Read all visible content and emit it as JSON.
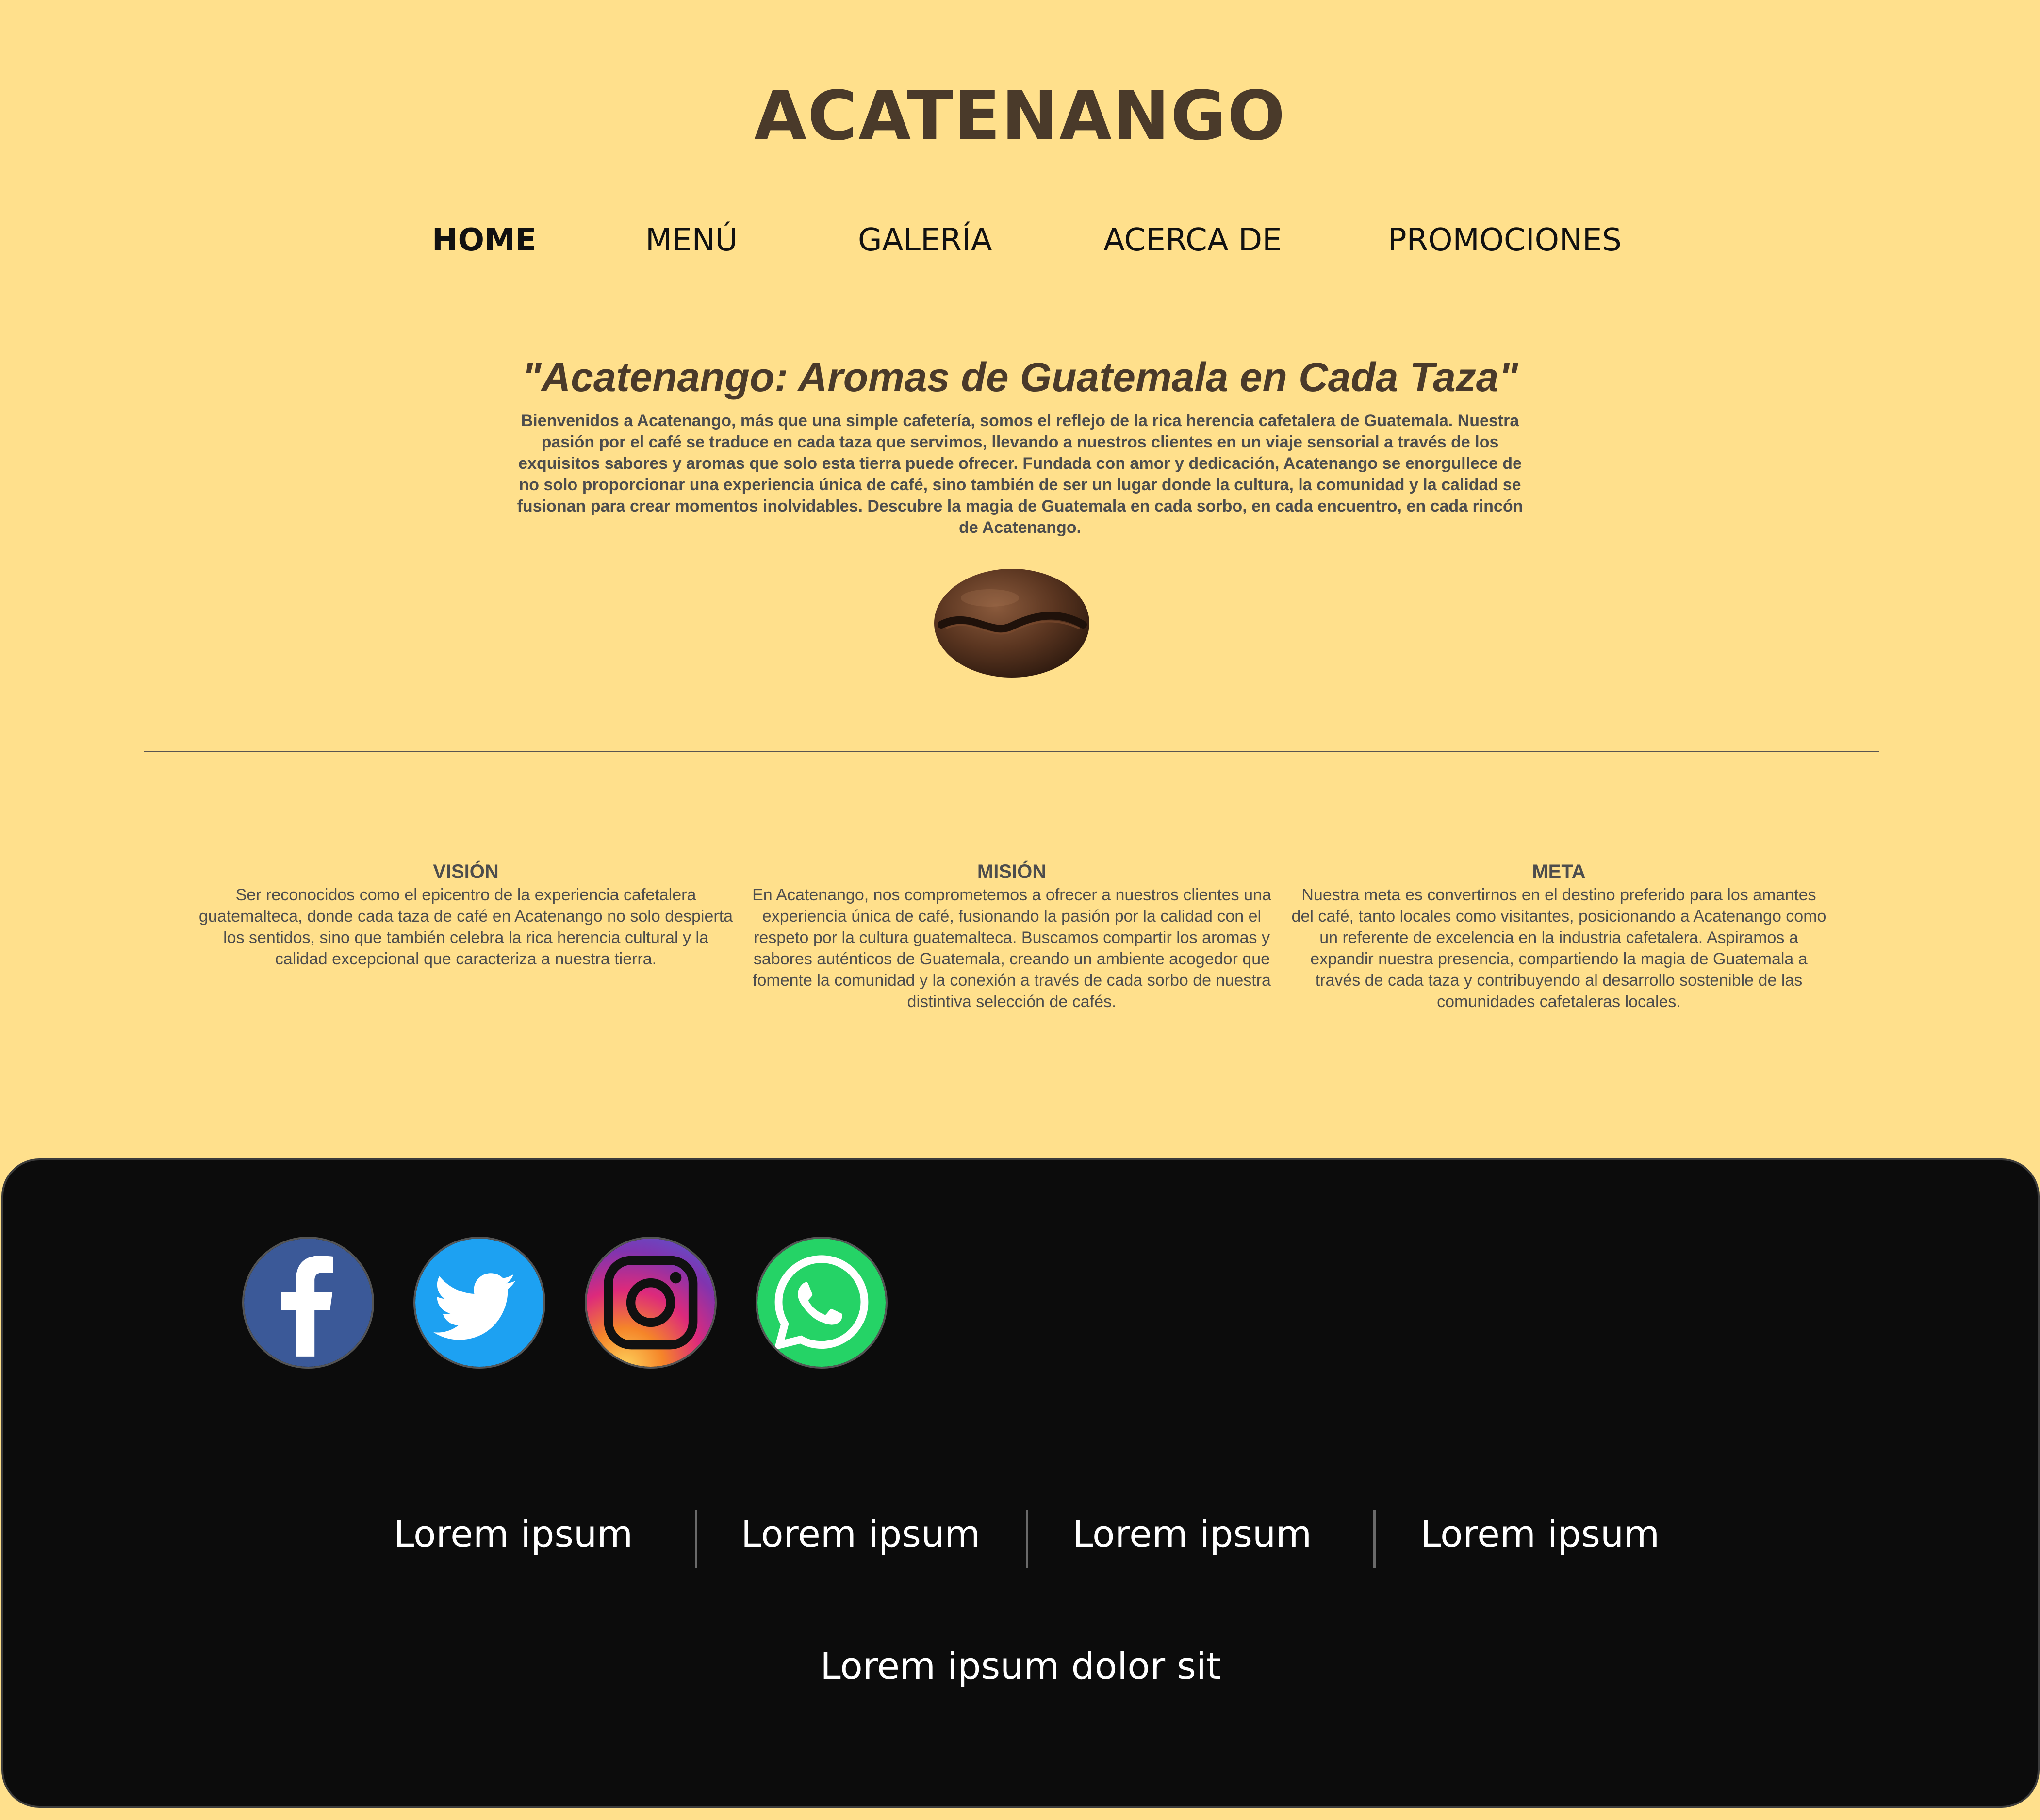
{
  "header": {
    "brand": "ACATENANGO"
  },
  "nav": {
    "items": [
      {
        "label": "HOME",
        "active": true
      },
      {
        "label": "MENÚ",
        "active": false
      },
      {
        "label": "GALERÍA",
        "active": false
      },
      {
        "label": "ACERCA DE",
        "active": false
      },
      {
        "label": "PROMOCIONES",
        "active": false
      }
    ]
  },
  "hero": {
    "title": "\"Acatenango: Aromas de Guatemala en Cada Taza\"",
    "text": "Bienvenidos a Acatenango, más que una simple cafetería, somos el reflejo de la rica herencia cafetalera de Guatemala. Nuestra pasión por el café se traduce en cada taza que servimos, llevando a nuestros clientes en un viaje sensorial a través de los exquisitos sabores y aromas que solo esta tierra puede ofrecer. Fundada con amor y dedicación, Acatenango se enorgullece de no solo proporcionar una experiencia única de café, sino también de ser un lugar donde la cultura, la comunidad y la calidad se fusionan para crear momentos inolvidables. Descubre la magia de Guatemala en cada sorbo, en cada encuentro, en cada rincón de Acatenango.",
    "image": "coffee-bean-image"
  },
  "columns": [
    {
      "title": "VISIÓN",
      "text": "Ser reconocidos como el epicentro de la experiencia cafetalera guatemalteca, donde cada taza de café en Acatenango no solo despierta los sentidos, sino que también celebra la rica herencia cultural y la calidad excepcional que caracteriza a nuestra tierra."
    },
    {
      "title": "MISIÓN",
      "text": "En Acatenango, nos comprometemos a ofrecer a nuestros clientes una experiencia única de café, fusionando la pasión por la calidad con el respeto por la cultura guatemalteca. Buscamos compartir los aromas y sabores auténticos de Guatemala, creando un ambiente acogedor que fomente la comunidad y la conexión a través de cada sorbo de nuestra distintiva selección de cafés."
    },
    {
      "title": "META",
      "text": "Nuestra meta es convertirnos en el destino preferido para los amantes del café, tanto locales como visitantes, posicionando a Acatenango como un referente de excelencia en la industria cafetalera. Aspiramos a expandir nuestra presencia, compartiendo la magia de Guatemala a través de cada taza y contribuyendo al desarrollo sostenible de las comunidades cafetaleras locales."
    }
  ],
  "footer": {
    "social": [
      {
        "icon": "facebook-icon",
        "color": "#3b5998"
      },
      {
        "icon": "twitter-icon",
        "color": "#1da1f2"
      },
      {
        "icon": "instagram-icon",
        "color": "#c13584"
      },
      {
        "icon": "whatsapp-icon",
        "color": "#25d366"
      }
    ],
    "links": [
      "Lorem ipsum",
      "Lorem ipsum",
      "Lorem ipsum",
      "Lorem ipsum"
    ],
    "copyright": "Lorem ipsum dolor sit"
  },
  "colors": {
    "background": "#ffe08c",
    "brand": "#4a3a2a",
    "footer": "#0c0c0c"
  }
}
